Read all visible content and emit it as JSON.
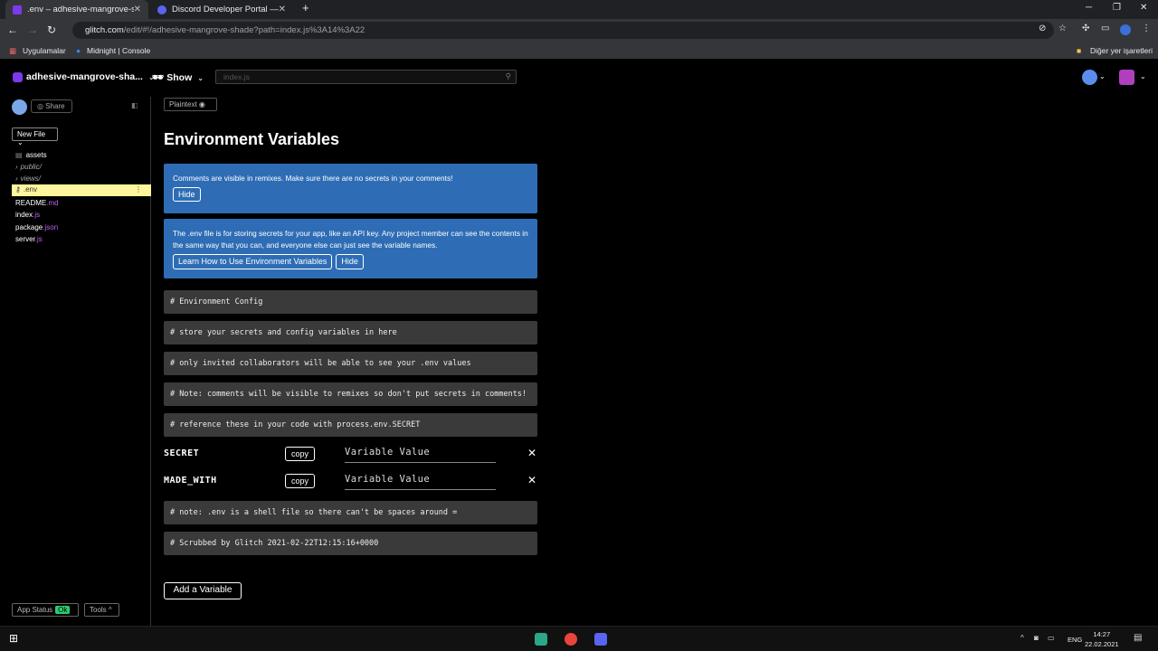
{
  "browser": {
    "tabs": [
      {
        "title": ".env – adhesive-mangrove-shade",
        "active": true
      },
      {
        "title": "Discord Developer Portal — My .",
        "active": false
      }
    ],
    "new_tab": "+",
    "url_host": "glitch.com",
    "url_path": "/edit/#!/adhesive-mangrove-shade?path=index.js%3A14%3A22",
    "bookmarks": {
      "apps": "Uygulamalar",
      "midnight": "Midnight | Console",
      "other": "Diğer yer işaretleri"
    }
  },
  "glitch": {
    "project_name": "adhesive-mangrove-sha...",
    "show_label": "Show",
    "file_search_placeholder": "index.js",
    "share_label": "Share",
    "new_file_label": "New File",
    "files": [
      {
        "name": "assets",
        "ext": "",
        "kind": "assets"
      },
      {
        "name": "public/",
        "ext": "",
        "kind": "folder"
      },
      {
        "name": "views/",
        "ext": "",
        "kind": "folder"
      },
      {
        "name": ".env",
        "ext": "",
        "kind": "active"
      },
      {
        "name": "README",
        "ext": ".md",
        "kind": "file"
      },
      {
        "name": "index",
        "ext": ".js",
        "kind": "file"
      },
      {
        "name": "package",
        "ext": ".json",
        "kind": "file"
      },
      {
        "name": "server",
        "ext": ".js",
        "kind": "file"
      }
    ],
    "app_status_label": "App Status",
    "app_status_value": "Ok",
    "tools_label": "Tools"
  },
  "main": {
    "plaintext_label": "Plaintext",
    "title": "Environment Variables",
    "notice1": {
      "text": "Comments are visible in remixes. Make sure there are no secrets in your comments!",
      "hide": "Hide"
    },
    "notice2": {
      "text": "The .env file is for storing secrets for your app, like an API key. Any project member can see the contents in the same way that you can, and everyone else can just see the variable names.",
      "learn": "Learn How to Use Environment Variables",
      "hide": "Hide"
    },
    "comments_top": [
      "# Environment Config",
      "# store your secrets and config variables in here",
      "# only invited collaborators will be able to see your .env values",
      "# Note: comments will be visible to remixes so don't put secrets in comments!",
      "# reference these in your code with process.env.SECRET"
    ],
    "variables": [
      {
        "key": "SECRET",
        "copy": "copy",
        "placeholder": "Variable Value",
        "remove": "✕"
      },
      {
        "key": "MADE_WITH",
        "copy": "copy",
        "placeholder": "Variable Value",
        "remove": "✕"
      }
    ],
    "comments_bottom": [
      "# note: .env is a shell file so there can't be spaces around =",
      "# Scrubbed by Glitch 2021-02-22T12:15:16+0000"
    ],
    "add_variable_label": "Add a Variable"
  },
  "taskbar": {
    "lang": "ENG",
    "time": "14:27",
    "date": "22.02.2021"
  }
}
